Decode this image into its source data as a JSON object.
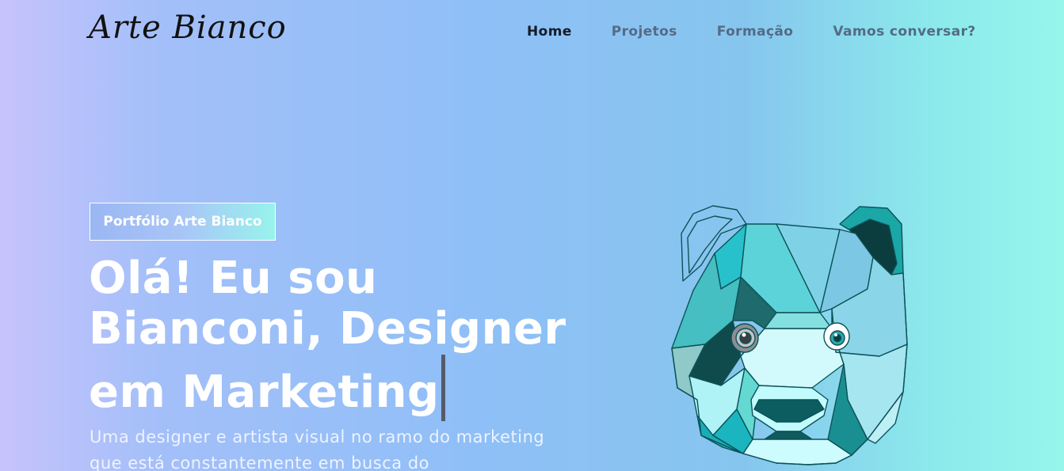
{
  "header": {
    "logo_text": "Arte Bianco",
    "nav": [
      {
        "label": "Home",
        "active": true
      },
      {
        "label": "Projetos",
        "active": false
      },
      {
        "label": "Formação",
        "active": false
      },
      {
        "label": "Vamos conversar?",
        "active": false
      }
    ]
  },
  "hero": {
    "badge": "Portfólio Arte Bianco",
    "title_line1": "Olá! Eu sou",
    "title_line2": "Bianconi, Designer",
    "title_line3": "em Marketing",
    "subtitle": "Uma designer e artista visual no ramo do marketing que está constantemente em busca do"
  },
  "colors": {
    "nav_active": "#141c2a",
    "nav_inactive": "#546b84",
    "panda_dark": "#0d4a4c",
    "panda_teal": "#27c1cc",
    "panda_light": "#d2fafc"
  },
  "illustration": {
    "icon": "geometric-panda-illustration"
  }
}
